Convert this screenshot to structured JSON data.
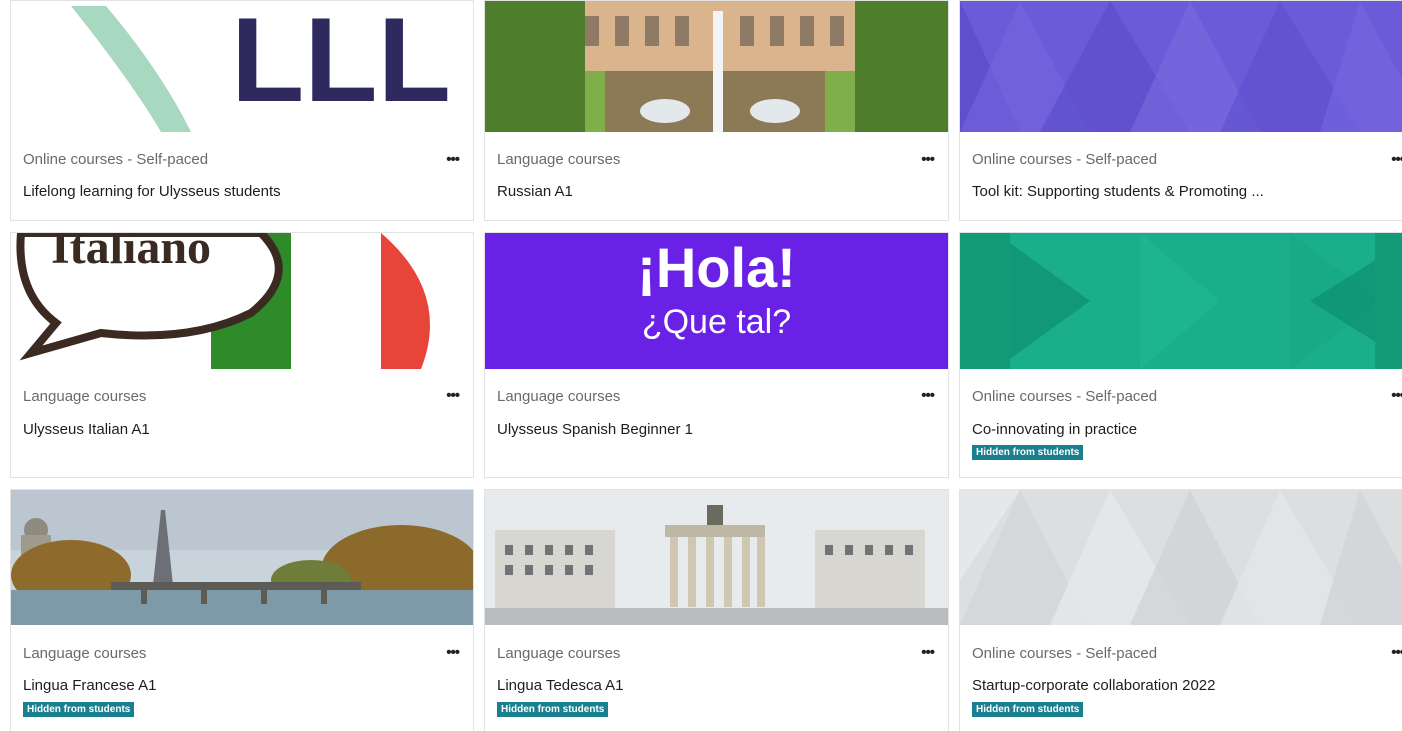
{
  "courses": [
    {
      "category": "Online courses - Self-paced",
      "name": "Lifelong learning for Ulysseus students",
      "menu": "•••",
      "image_text": "LLL",
      "hidden": false
    },
    {
      "category": "Language courses",
      "name": "Russian A1",
      "menu": "•••",
      "hidden": false
    },
    {
      "category": "Online courses - Self-paced",
      "name": "Tool kit: Supporting students & Promoting ...",
      "menu": "•••",
      "hidden": false
    },
    {
      "category": "Language courses",
      "name": "Ulysseus Italian A1",
      "menu": "•••",
      "image_text": "Italiano",
      "hidden": false
    },
    {
      "category": "Language courses",
      "name": "Ulysseus Spanish Beginner 1",
      "menu": "•••",
      "image_text": "¡Hola!",
      "image_subtext": "¿Que tal?",
      "hidden": false
    },
    {
      "category": "Online courses - Self-paced",
      "name": "Co-innovating in practice",
      "menu": "•••",
      "hidden": true,
      "badge": "Hidden from students"
    },
    {
      "category": "Language courses",
      "name": "Lingua Francese A1",
      "menu": "•••",
      "hidden": true,
      "badge": "Hidden from students"
    },
    {
      "category": "Language courses",
      "name": "Lingua Tedesca A1",
      "menu": "•••",
      "hidden": true,
      "badge": "Hidden from students"
    },
    {
      "category": "Online courses - Self-paced",
      "name": "Startup-corporate collaboration 2022",
      "menu": "•••",
      "hidden": true,
      "badge": "Hidden from students"
    }
  ],
  "colors": {
    "badge": "#1a7f8e",
    "purple_pattern": "#6b5bd8",
    "green_pattern": "#1aae8a",
    "grey_pattern": "#d9dbdd",
    "spanish_bg": "#6a21e6",
    "lll_text": "#2e2a5e"
  }
}
